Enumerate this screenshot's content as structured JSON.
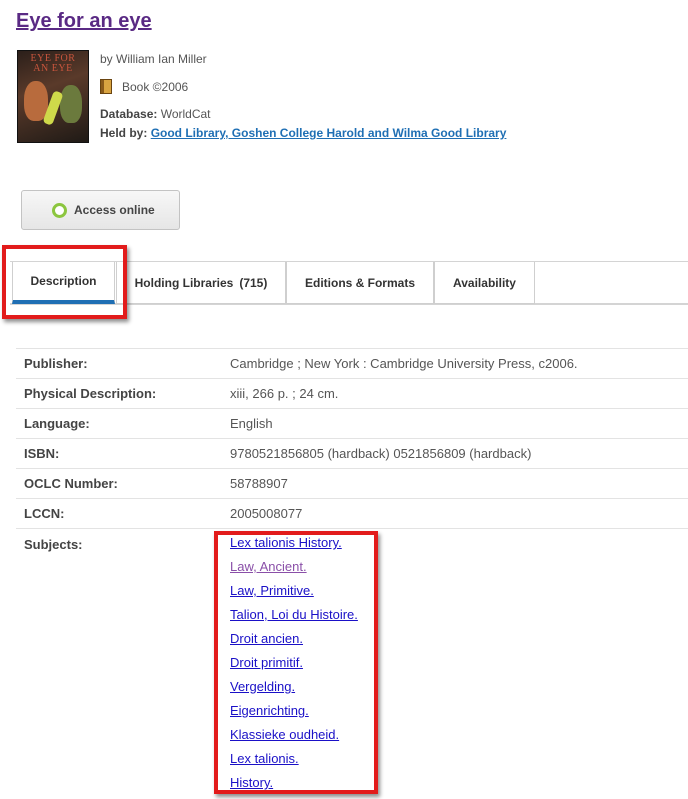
{
  "record": {
    "title": "Eye for an eye",
    "author": "by William Ian Miller",
    "format": "Book ©2006",
    "database_label": "Database:",
    "database_value": "WorldCat",
    "held_label": "Held by:",
    "held_value": "Good Library, Goshen College Harold and Wilma Good Library",
    "cover_title": "EYE FOR AN EYE"
  },
  "access_button": {
    "label": "Access online"
  },
  "tabs": [
    {
      "label": "Description"
    },
    {
      "label": "Holding Libraries",
      "count": "(715)"
    },
    {
      "label": "Editions & Formats"
    },
    {
      "label": "Availability"
    }
  ],
  "details": [
    {
      "label": "Publisher:",
      "value": "Cambridge ; New York : Cambridge University Press, c2006."
    },
    {
      "label": "Physical Description:",
      "value": "xiii, 266 p. ; 24 cm."
    },
    {
      "label": "Language:",
      "value": "English"
    },
    {
      "label": "ISBN:",
      "value": "9780521856805 (hardback) 0521856809 (hardback)"
    },
    {
      "label": "OCLC Number:",
      "value": "58788907"
    },
    {
      "label": "LCCN:",
      "value": "2005008077"
    }
  ],
  "subjects": {
    "label": "Subjects:",
    "items": [
      "Lex talionis History.",
      "Law, Ancient.",
      "Law, Primitive.",
      "Talion, Loi du Histoire.",
      "Droit ancien.",
      "Droit primitif.",
      "Vergelding.",
      "Eigenrichting.",
      "Klassieke oudheid.",
      "Lex talionis.",
      "History."
    ]
  },
  "colors": {
    "title": "#5a2a84",
    "link": "#1a10c7",
    "visited_link": "#8a4fa8",
    "tab_active": "#1f6fb4",
    "highlight": "#e21b1b",
    "access_icon": "#8cc63f"
  }
}
